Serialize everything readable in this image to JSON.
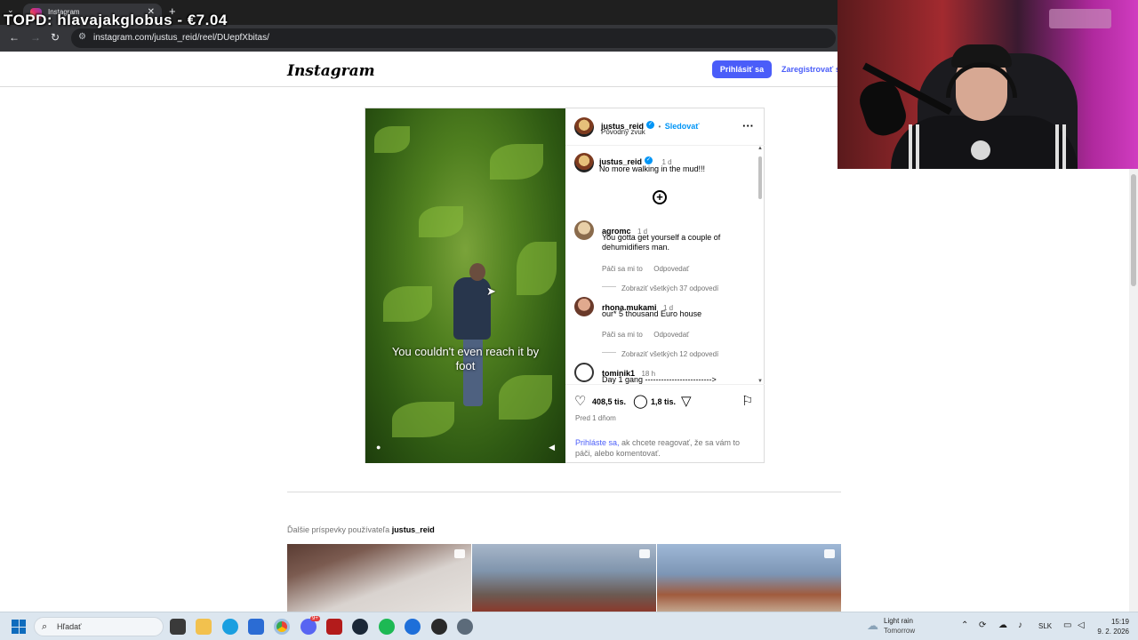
{
  "overlay": {
    "text": "TOPD: hlavajakglobus - €7.04"
  },
  "browser": {
    "tab_title": "Instagram",
    "url": "instagram.com/justus_reid/reel/DUepfXbitas/"
  },
  "instagram": {
    "logo": "Instagram",
    "login_label": "Prihlásiť sa",
    "signup_label": "Zaregistrovať sa"
  },
  "post": {
    "video_caption": "You couldn't even reach it by foot",
    "author": "justus_reid",
    "follow_label": "Sledovať",
    "separator": "•",
    "audio": "Pôvodný zvuk",
    "caption_user": "justus_reid",
    "caption_time": "1 d",
    "caption_text": "No more walking in the mud!!!",
    "comments": [
      {
        "user": "agromc",
        "time": "1 d",
        "text": "You gotta get yourself a couple of dehumidifiers man.",
        "likes": "Páči sa mi to",
        "reply": "Odpovedať",
        "view_replies": "Zobraziť všetkých 37 odpovedí"
      },
      {
        "user": "rhona.mukami",
        "time": "1 d",
        "text": "our* 5 thousand Euro house",
        "likes": "Páči sa mi to",
        "reply": "Odpovedať",
        "view_replies": "Zobraziť všetkých 12 odpovedí"
      },
      {
        "user": "tominik1",
        "time": "18 h",
        "text": "Day 1 gang ------------------------->"
      }
    ],
    "like_count": "408,5 tis.",
    "comment_count": "1,8 tis.",
    "posted": "Pred 1 dňom",
    "login_link": "Prihláste sa,",
    "login_rest": " ak chcete reagovať, že sa vám to páči, alebo komentovať."
  },
  "more_posts": {
    "prefix": "Ďalšie príspevky používateľa ",
    "user": "justus_reid"
  },
  "taskbar": {
    "search_placeholder": "Hľadať",
    "weather_line1": "Light rain",
    "weather_line2": "Tomorrow",
    "lang": "SLK",
    "time": "15:19",
    "date": "9. 2. 2026",
    "discord_badge": "9+"
  },
  "colors": {
    "ig_blue": "#4a5df9",
    "verified": "#0095f6"
  }
}
